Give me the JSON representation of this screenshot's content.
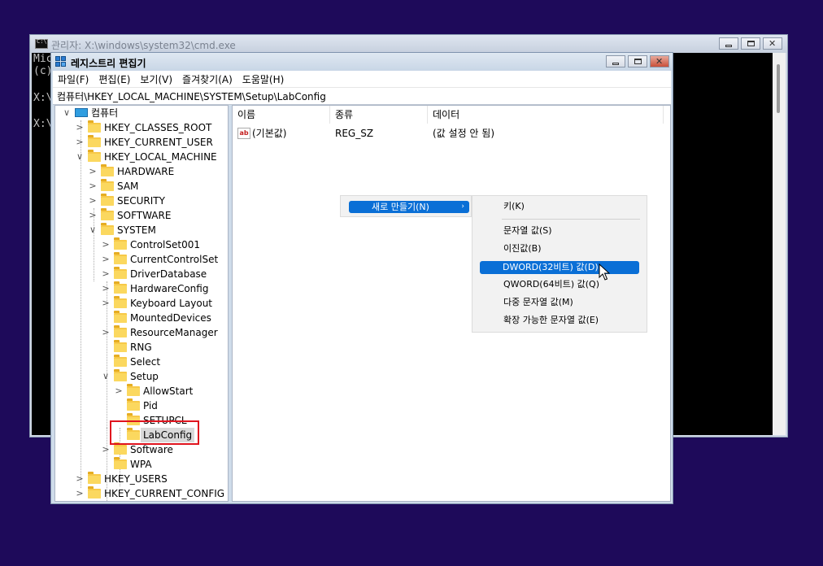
{
  "cmd": {
    "title": "관리자: X:\\windows\\system32\\cmd.exe",
    "lines": [
      "Mic",
      "(c)",
      "X:\\",
      "X:\\"
    ]
  },
  "regedit": {
    "title": "레지스트리 편집기",
    "menu": [
      "파일(F)",
      "편집(E)",
      "보기(V)",
      "즐겨찾기(A)",
      "도움말(H)"
    ],
    "address": "컴퓨터\\HKEY_LOCAL_MACHINE\\SYSTEM\\Setup\\LabConfig",
    "tree": [
      {
        "label": "컴퓨터",
        "chev": "∨"
      },
      {
        "label": "HKEY_CLASSES_ROOT",
        "chev": ">"
      },
      {
        "label": "HKEY_CURRENT_USER",
        "chev": ">"
      },
      {
        "label": "HKEY_LOCAL_MACHINE",
        "chev": "∨"
      },
      {
        "label": "HARDWARE",
        "chev": ">"
      },
      {
        "label": "SAM",
        "chev": ">"
      },
      {
        "label": "SECURITY",
        "chev": ">"
      },
      {
        "label": "SOFTWARE",
        "chev": ">"
      },
      {
        "label": "SYSTEM",
        "chev": "∨"
      },
      {
        "label": "ControlSet001",
        "chev": ">"
      },
      {
        "label": "CurrentControlSet",
        "chev": ">"
      },
      {
        "label": "DriverDatabase",
        "chev": ">"
      },
      {
        "label": "HardwareConfig",
        "chev": ">"
      },
      {
        "label": "Keyboard Layout",
        "chev": ">"
      },
      {
        "label": "MountedDevices",
        "chev": ""
      },
      {
        "label": "ResourceManager",
        "chev": ">"
      },
      {
        "label": "RNG",
        "chev": ""
      },
      {
        "label": "Select",
        "chev": ""
      },
      {
        "label": "Setup",
        "chev": "∨"
      },
      {
        "label": "AllowStart",
        "chev": ">"
      },
      {
        "label": "Pid",
        "chev": ""
      },
      {
        "label": "SETUPCL",
        "chev": ""
      },
      {
        "label": "LabConfig",
        "chev": ""
      },
      {
        "label": "Software",
        "chev": ">"
      },
      {
        "label": "WPA",
        "chev": ""
      },
      {
        "label": "HKEY_USERS",
        "chev": ">"
      },
      {
        "label": "HKEY_CURRENT_CONFIG",
        "chev": ">"
      }
    ],
    "columns": {
      "name": "이름",
      "type": "종류",
      "data": "데이터"
    },
    "rows": [
      {
        "icon": "ab",
        "name": "(기본값)",
        "type": "REG_SZ",
        "data": "(값 설정 안 됨)"
      }
    ]
  },
  "context_menu": {
    "new": "새로 만들기(N)",
    "new_arrow": "›",
    "items": [
      "키(K)",
      "문자열 값(S)",
      "이진값(B)",
      "DWORD(32비트) 값(D)",
      "QWORD(64비트) 값(Q)",
      "다중 문자열 값(M)",
      "확장 가능한 문자열 값(E)"
    ]
  }
}
